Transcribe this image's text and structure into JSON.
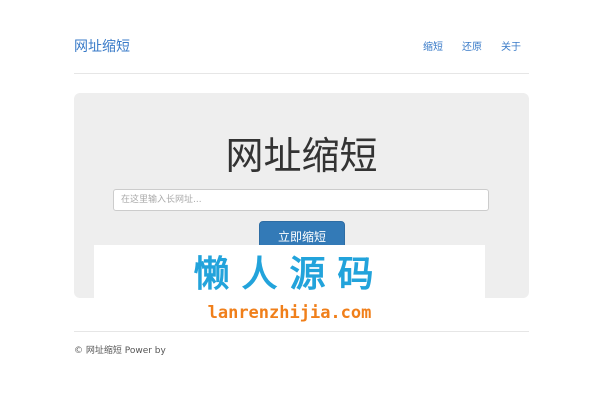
{
  "header": {
    "site_title": "网址缩短",
    "nav": [
      "缩短",
      "还原",
      "关于"
    ]
  },
  "hero": {
    "title": "网址缩短",
    "input_placeholder": "在这里输入长网址...",
    "input_value": "",
    "button_label": "立即缩短"
  },
  "watermark": {
    "chinese": "懒人源码",
    "domain": "lanrenzhijia.com"
  },
  "footer": {
    "text": "© 网址缩短 Power by"
  },
  "colors": {
    "link": "#3a7bc8",
    "button": "#337ab7",
    "jumbotron_bg": "#eeeeee",
    "watermark_cn": "#22a3db",
    "watermark_en": "#f07f1a"
  }
}
